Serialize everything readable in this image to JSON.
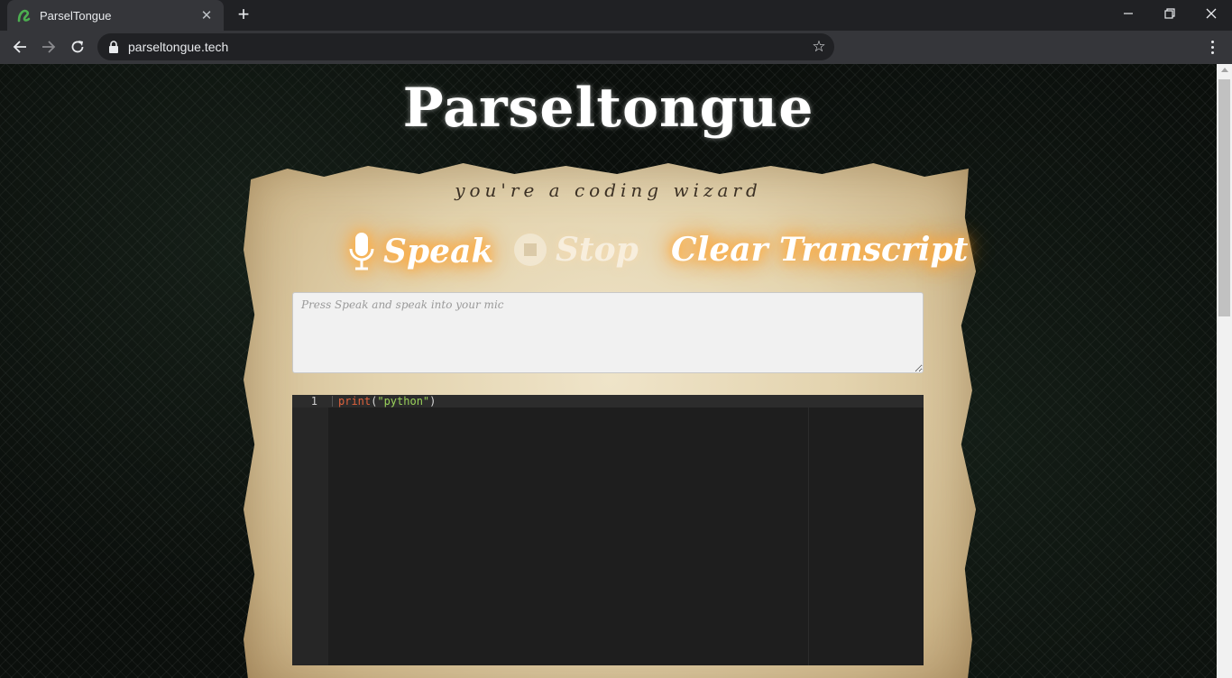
{
  "browser": {
    "tab_title": "ParselTongue",
    "tab_close": "✕",
    "new_tab": "+",
    "url": "parseltongue.tech",
    "bookmark_star": "☆",
    "icons": [
      "favicon-icon",
      "back-icon",
      "forward-icon",
      "reload-icon",
      "lock-icon",
      "star-icon",
      "menu-icon",
      "minimize-icon",
      "restore-icon",
      "close-icon"
    ]
  },
  "page": {
    "title": "Parseltongue",
    "subtitle": "you're a coding wizard",
    "buttons": {
      "speak": "Speak",
      "stop": "Stop",
      "clear": "Clear Transcript"
    },
    "transcript": {
      "placeholder": "Press Speak and speak into your mic",
      "value": ""
    },
    "editor": {
      "line_number": "1",
      "code_fn": "print",
      "code_open": "(",
      "code_str": "\"python\"",
      "code_close": ")"
    },
    "colors": {
      "glow": "#ff9d2b",
      "parchment": "#e3d3ae",
      "editor_bg": "#1e1e1e"
    }
  }
}
